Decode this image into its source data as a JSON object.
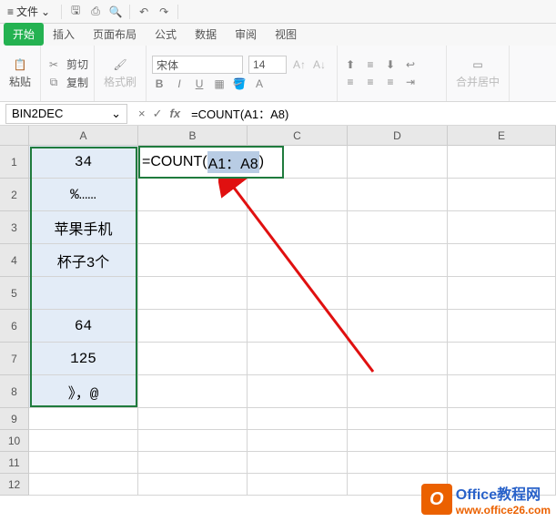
{
  "titlebar": {
    "file_label": "文件"
  },
  "tabs": {
    "start": "开始",
    "insert": "插入",
    "pagelayout": "页面布局",
    "formula": "公式",
    "data": "数据",
    "review": "审阅",
    "view": "视图"
  },
  "ribbon": {
    "paste": "粘贴",
    "cut": "剪切",
    "copy": "复制",
    "format_painter": "格式刷",
    "font_name": "宋体",
    "font_size": "14",
    "merge_center": "合并居中"
  },
  "fbar": {
    "namebox": "BIN2DEC",
    "cancel": "×",
    "confirm": "✓",
    "fx": "fx",
    "formula": "=COUNT(A1：A8)"
  },
  "columns": [
    "A",
    "B",
    "C",
    "D",
    "E"
  ],
  "rows": [
    "1",
    "2",
    "3",
    "4",
    "5",
    "6",
    "7",
    "8",
    "9",
    "10",
    "11",
    "12"
  ],
  "cells": {
    "A1": "34",
    "A2": "%……",
    "A3": "苹果手机",
    "A4": "杯子3个",
    "A5": "",
    "A6": "64",
    "A7": "125",
    "A8": "》，@",
    "B1_prefix": "=COUNT(",
    "B1_range": "A1：A8",
    "B1_suffix": ")"
  },
  "watermark": {
    "title": "Office教程网",
    "url": "www.office26.com"
  }
}
